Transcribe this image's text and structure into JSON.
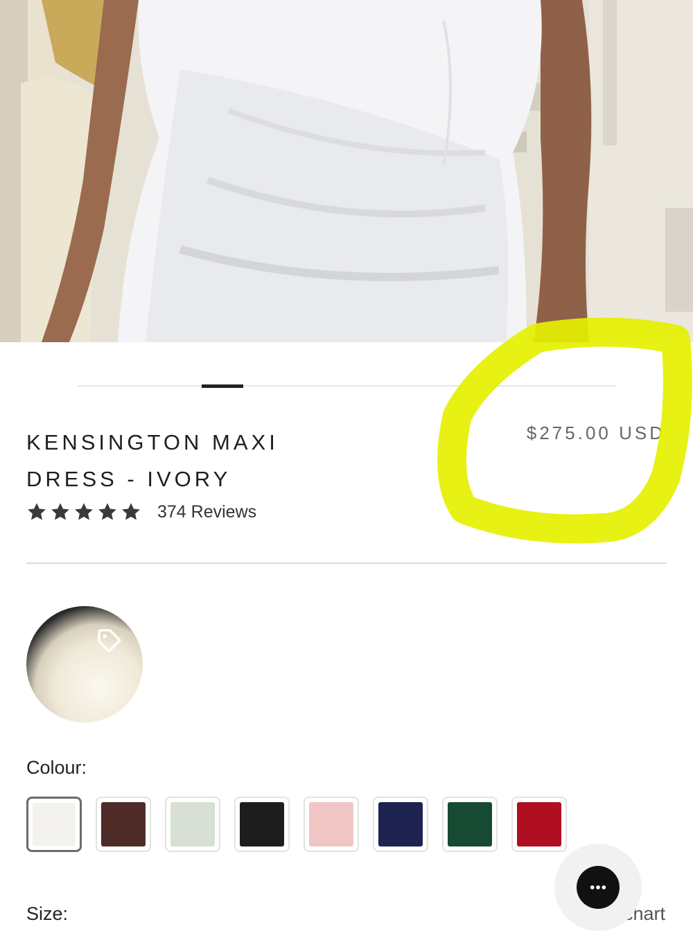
{
  "product": {
    "title": "KENSINGTON MAXI DRESS - IVORY",
    "price": "$275.00 USD",
    "rating_stars": 5,
    "reviews_text": "374 Reviews"
  },
  "gallery": {
    "progress": 0.25
  },
  "options": {
    "colour_label": "Colour:",
    "colours": [
      {
        "name": "ivory",
        "hex": "#f3f2ef",
        "selected": true
      },
      {
        "name": "chocolate",
        "hex": "#4e2b27"
      },
      {
        "name": "sage",
        "hex": "#d8e0d6"
      },
      {
        "name": "black",
        "hex": "#1d1d1d"
      },
      {
        "name": "blush",
        "hex": "#f0c6c4"
      },
      {
        "name": "navy",
        "hex": "#1e2250"
      },
      {
        "name": "emerald",
        "hex": "#164a33"
      },
      {
        "name": "red",
        "hex": "#b00f21"
      }
    ],
    "size_label": "Size:",
    "size_chart_link": "chart"
  },
  "icons": {
    "tag": "tag-icon",
    "chat": "chat-bubble-icon",
    "star": "star-icon"
  },
  "highlight_color": "#e5f000"
}
